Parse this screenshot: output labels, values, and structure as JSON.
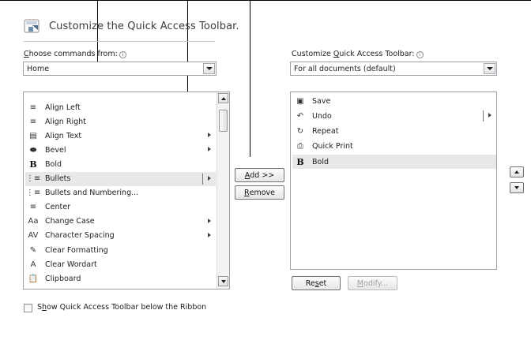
{
  "title": "Customize the Quick Access Toolbar.",
  "choose_commands": {
    "label_pre": "",
    "label_u": "C",
    "label_post": "hoose commands from:",
    "help": "i",
    "value": "Home"
  },
  "customize_toolbar": {
    "label_pre": "Customize ",
    "label_u": "Q",
    "label_post": "uick Access Toolbar:",
    "help": "i",
    "value": "For all documents (default)"
  },
  "commands": [
    {
      "label": "Align Left",
      "icon": "align-left-icon",
      "glyph": "≡",
      "submenu": false
    },
    {
      "label": "Align Right",
      "icon": "align-right-icon",
      "glyph": "≡",
      "submenu": false
    },
    {
      "label": "Align Text",
      "icon": "align-text-icon",
      "glyph": "▤",
      "submenu": true
    },
    {
      "label": "Bevel",
      "icon": "bevel-icon",
      "glyph": "⬬",
      "submenu": true
    },
    {
      "label": "Bold",
      "icon": "bold-icon",
      "glyph": "B",
      "submenu": false
    },
    {
      "label": "Bullets",
      "icon": "bullets-icon",
      "glyph": "⋮≡",
      "submenu": true,
      "selected": true
    },
    {
      "label": "Bullets and Numbering...",
      "icon": "bullets-numbering-icon",
      "glyph": "⋮≡",
      "submenu": false
    },
    {
      "label": "Center",
      "icon": "center-icon",
      "glyph": "≡",
      "submenu": false
    },
    {
      "label": "Change Case",
      "icon": "change-case-icon",
      "glyph": "Aa",
      "submenu": true
    },
    {
      "label": "Character Spacing",
      "icon": "character-spacing-icon",
      "glyph": "AV",
      "submenu": true
    },
    {
      "label": "Clear Formatting",
      "icon": "clear-formatting-icon",
      "glyph": "✎",
      "submenu": false
    },
    {
      "label": "Clear Wordart",
      "icon": "clear-wordart-icon",
      "glyph": "A",
      "submenu": false
    },
    {
      "label": "Clipboard",
      "icon": "clipboard-icon",
      "glyph": "📋",
      "submenu": false
    }
  ],
  "toolbar_items": [
    {
      "label": "Save",
      "icon": "save-icon",
      "glyph": "▣",
      "submenu": false
    },
    {
      "label": "Undo",
      "icon": "undo-icon",
      "glyph": "↶",
      "submenu": true
    },
    {
      "label": "Repeat",
      "icon": "repeat-icon",
      "glyph": "↻",
      "submenu": false
    },
    {
      "label": "Quick Print",
      "icon": "quick-print-icon",
      "glyph": "⎙",
      "submenu": false
    },
    {
      "label": "Bold",
      "icon": "bold-icon",
      "glyph": "B",
      "submenu": false,
      "selected": true
    }
  ],
  "buttons": {
    "add_u": "A",
    "add_post": "dd >>",
    "remove_u": "R",
    "remove_post": "emove",
    "reset_pre": "Re",
    "reset_u": "s",
    "reset_post": "et",
    "modify_u": "M",
    "modify_post": "odify..."
  },
  "show_below": {
    "label_pre": "S",
    "label_u": "h",
    "label_post": "ow Quick Access Toolbar below the Ribbon",
    "checked": false
  }
}
